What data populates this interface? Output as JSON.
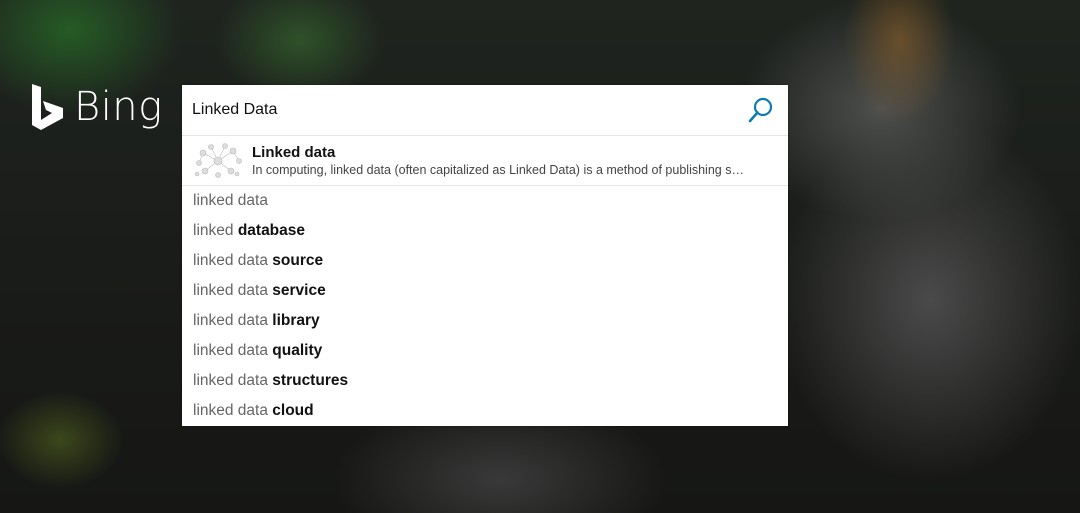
{
  "brand": {
    "name": "Bing"
  },
  "search": {
    "query": "Linked Data"
  },
  "entity": {
    "title": "Linked data",
    "description": "In computing, linked data (often capitalized as Linked Data) is a method of publishing s…"
  },
  "suggestions": [
    {
      "prefix": "linked data",
      "suffix": ""
    },
    {
      "prefix": "linked ",
      "suffix": "database"
    },
    {
      "prefix": "linked data ",
      "suffix": "source"
    },
    {
      "prefix": "linked data ",
      "suffix": "service"
    },
    {
      "prefix": "linked data ",
      "suffix": "library"
    },
    {
      "prefix": "linked data ",
      "suffix": "quality"
    },
    {
      "prefix": "linked data ",
      "suffix": "structures"
    },
    {
      "prefix": "linked data ",
      "suffix": "cloud"
    }
  ],
  "colors": {
    "brand_accent": "#0c7db0",
    "logo": "#ffffff",
    "suggestion_prefix": "#666666",
    "suggestion_bold": "#111111"
  },
  "icons": {
    "search": "search-icon",
    "logo": "bing-logo-icon",
    "entity_thumbnail": "linked-data-graph-thumbnail"
  }
}
